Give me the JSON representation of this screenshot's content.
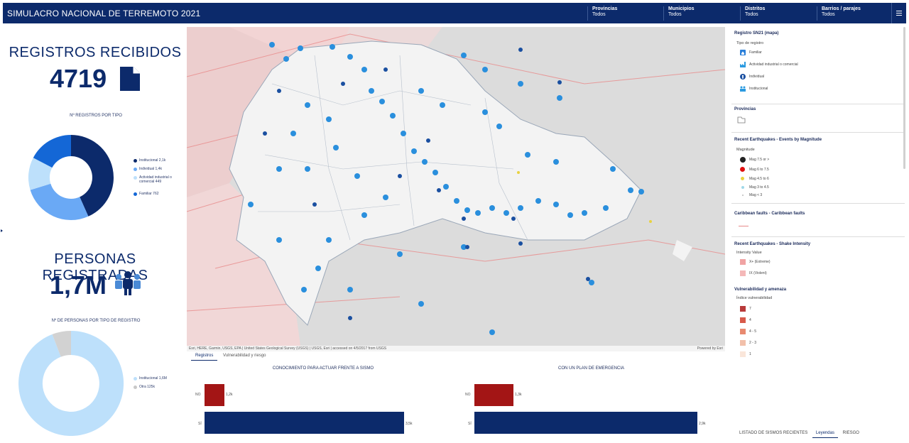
{
  "header": {
    "title": "SIMULACRO NACIONAL DE TERREMOTO 2021",
    "filters": [
      {
        "label": "Provincias",
        "value": "Todos"
      },
      {
        "label": "Municipios",
        "value": "Todos"
      },
      {
        "label": "Distritos",
        "value": "Todos"
      },
      {
        "label": "Barrios / parajes",
        "value": "Todos"
      }
    ]
  },
  "kpi_registros": {
    "title": "REGISTROS RECIBIDOS",
    "value": "4719",
    "icon": "document-icon"
  },
  "kpi_personas": {
    "title": "PERSONAS REGISTRADAS",
    "value": "1,7M",
    "icon": "people-icon"
  },
  "donut_tipo": {
    "title": "Nº REGISTROS POR TIPO",
    "legend": [
      {
        "label": "Institucional 2,1k",
        "color": "#0c2a6b"
      },
      {
        "label": "Individual 1,4k",
        "color": "#6aa9f5"
      },
      {
        "label": "Actividad industrial o comercial 449",
        "color": "#bde0fb"
      },
      {
        "label": "Familiar 762",
        "color": "#1467d6"
      }
    ]
  },
  "donut_personas": {
    "title": "Nº DE PERSONAS POR TIPO DE REGISTRO",
    "legend": [
      {
        "label": "Institucional 1,6M",
        "color": "#bde0fb"
      },
      {
        "label": "Otra 125k",
        "color": "#c8c8c8"
      }
    ]
  },
  "map": {
    "attribution": "Esri, HERE, Garmin, USGS, EPA | United States Geological Survey (USGS) | USGS, Esri | accessed on 4/5/2017 from USGS",
    "powered": "Powered by Esri"
  },
  "map_tabs": [
    "Registros",
    "Vulnerabilidad y riesgo"
  ],
  "legend_panel": {
    "sections": [
      {
        "title": "Registro SN21 (mapa)",
        "subtitle": "Tipo de registro",
        "items": [
          {
            "label": "Familiar",
            "color": "#2a7fd9",
            "icon": "house-icon"
          },
          {
            "label": "Actividad industrial o comercial",
            "color": "#2a9ae0",
            "icon": "factory-icon"
          },
          {
            "label": "Individual",
            "color": "#1a4fa0",
            "icon": "person-pin-icon"
          },
          {
            "label": "Institucional",
            "color": "#2a9ae0",
            "icon": "institution-icon"
          }
        ]
      },
      {
        "title": "Provincias",
        "subtitle": "",
        "items": []
      },
      {
        "title": "Recent Earthquakes - Events by Magnitude",
        "subtitle": "Magnitude",
        "items": [
          {
            "label": "Mag 7.5 or >",
            "color": "#222222"
          },
          {
            "label": "Mag 6 to 7.5",
            "color": "#e01010"
          },
          {
            "label": "Mag 4.5 to 6",
            "color": "#e8d240"
          },
          {
            "label": "Mag 3 to 4.5",
            "color": "#9fd8e8"
          },
          {
            "label": "Mag < 3",
            "color": "#bbbbbb"
          }
        ]
      },
      {
        "title": "Caribbean faults - Caribbean faults",
        "subtitle": "",
        "items": []
      },
      {
        "title": "Recent Earthquakes - Shake Intensity",
        "subtitle": "Intensity Value",
        "items": [
          {
            "label": "X+ (Extreme)",
            "color": "#f0a3a3"
          },
          {
            "label": "IX (Violent)",
            "color": "#f4b8b8"
          }
        ]
      },
      {
        "title": "Vulnerabilidad y amenaza",
        "subtitle": "Índice vulnerabilidad",
        "items": [
          {
            "label": "7",
            "color": "#b83a3a"
          },
          {
            "label": "4",
            "color": "#d85a4a"
          },
          {
            "label": "4 - 5",
            "color": "#e88a70"
          },
          {
            "label": "2 - 3",
            "color": "#f2c0aa"
          },
          {
            "label": "1",
            "color": "#fae6da"
          }
        ]
      }
    ]
  },
  "bar_conocimiento": {
    "title": "CONOCIMIENTO PARA ACTUAR FRENTE A SISMO",
    "categories": [
      "NO",
      "SÍ"
    ],
    "values_labels": [
      "1,2k",
      "3,5k"
    ]
  },
  "bar_plan": {
    "title": "CON UN PLAN DE EMERGENCIA",
    "categories": [
      "NO",
      "SÍ"
    ],
    "values_labels": [
      "1,3k",
      "2,9k"
    ]
  },
  "bottom_tabs": [
    "LISTADO DE SISMOS RECIENTES",
    "Leyendas",
    "RIESGO"
  ],
  "colors": {
    "brand": "#0c2a6b",
    "no_bar": "#a31515",
    "si_bar": "#0c2a6b"
  }
}
